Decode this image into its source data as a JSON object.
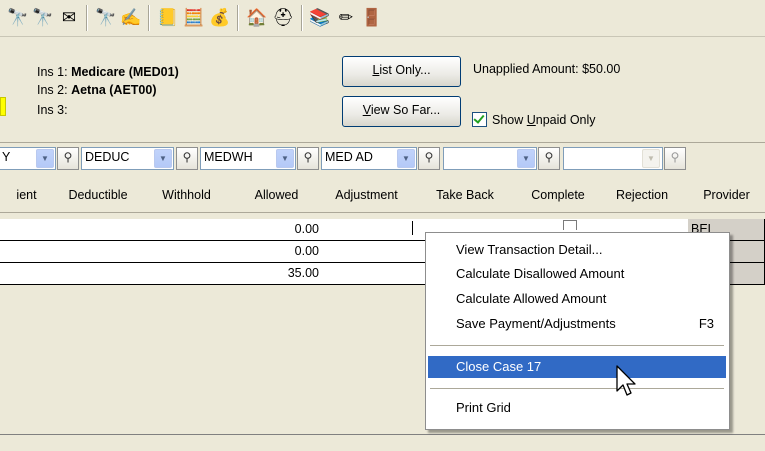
{
  "toolbar": {
    "icons": [
      "binoculars-icon",
      "binoculars-person-icon",
      "letter-icon",
      "binoculars-search-icon",
      "edit-letter-icon",
      "ledger-icon",
      "calculator-icon",
      "money-bag-icon",
      "house-icon",
      "life-ring-icon",
      "books-icon",
      "pencil-wand-icon",
      "exit-door-icon"
    ]
  },
  "insurance": {
    "ins1_label": "Ins 1:",
    "ins1_value": "Medicare (MED01)",
    "ins2_label": "Ins 2:",
    "ins2_value": "Aetna (AET00)",
    "ins3_label": "Ins 3:",
    "ins3_value": ""
  },
  "buttons": {
    "list_only_ul": "L",
    "list_only_rest": "ist Only...",
    "view_so_far_ul": "V",
    "view_so_far_rest": "iew So Far..."
  },
  "unapplied_amount": "Unapplied Amount: $50.00",
  "show_unpaid": {
    "pre": "Show ",
    "ul": "U",
    "rest": "npaid Only",
    "checked": true
  },
  "filters": [
    "Y",
    "DEDUC",
    "MEDWH",
    "MED AD",
    "",
    ""
  ],
  "grid": {
    "columns": [
      "ient",
      "Deductible",
      "Withhold",
      "Allowed",
      "Adjustment",
      "Take Back",
      "Complete",
      "Rejection",
      "Provider"
    ],
    "rows": [
      {
        "allowed": "0.00",
        "provider": "BEL"
      },
      {
        "allowed": "0.00",
        "provider": ""
      },
      {
        "allowed": "35.00",
        "provider": ""
      }
    ]
  },
  "context_menu": {
    "items": [
      {
        "label": "View Transaction Detail...",
        "shortcut": ""
      },
      {
        "label": "Calculate Disallowed Amount",
        "shortcut": ""
      },
      {
        "label": "Calculate Allowed Amount",
        "shortcut": ""
      },
      {
        "label": "Save Payment/Adjustments",
        "shortcut": "F3"
      },
      {
        "label": "Close Case  17",
        "shortcut": "",
        "selected": true
      },
      {
        "label": "Print Grid",
        "shortcut": ""
      }
    ]
  },
  "colors": {
    "window_bg": "#ece9d8",
    "menu_highlight": "#316ac5",
    "highlight_marker": "#ffff00"
  }
}
